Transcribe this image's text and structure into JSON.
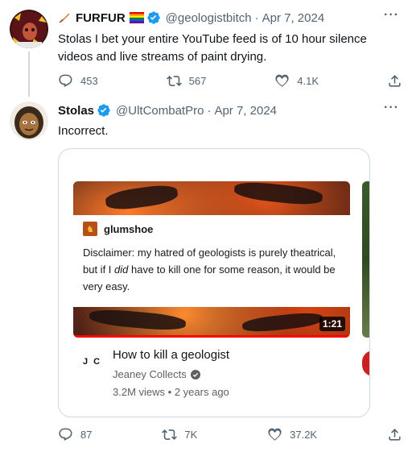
{
  "tweet1": {
    "name": "FURFUR",
    "handle": "@geologistbitch",
    "date": "Apr 7, 2024",
    "separator": "·",
    "text": "Stolas I bet your entire YouTube feed is of 10 hour silence videos and live streams of paint drying.",
    "more": "···",
    "replies": "453",
    "retweets": "567",
    "likes": "4.1K"
  },
  "tweet2": {
    "name": "Stolas",
    "handle": "@UltCombatPro",
    "date": "Apr 7, 2024",
    "separator": "·",
    "text": "Incorrect.",
    "more": "···",
    "replies": "87",
    "retweets": "7K",
    "likes": "37.2K"
  },
  "card": {
    "tumblr_user": "glumshoe",
    "tumblr_text_before": "Disclaimer: my hatred of geologists is purely theatrical, but if I ",
    "tumblr_text_em": "did",
    "tumblr_text_after": " have to kill one for some reason, it would be very easy.",
    "duration": "1:21",
    "channel_mark": "J C",
    "video_title": "How to kill a geologist",
    "channel_name": "Jeaney Collects",
    "views": "3.2M views",
    "age": "2 years ago",
    "meta_separator": "•"
  },
  "colors": {
    "verified": "#1d9bf0",
    "secondary_text": "#536471",
    "youtube_red": "#ff0000"
  },
  "icons": [
    "reply-icon",
    "retweet-icon",
    "like-icon",
    "share-icon",
    "verified-badge-icon",
    "feather-icon",
    "rainbow-flag-icon",
    "channel-verified-icon"
  ]
}
